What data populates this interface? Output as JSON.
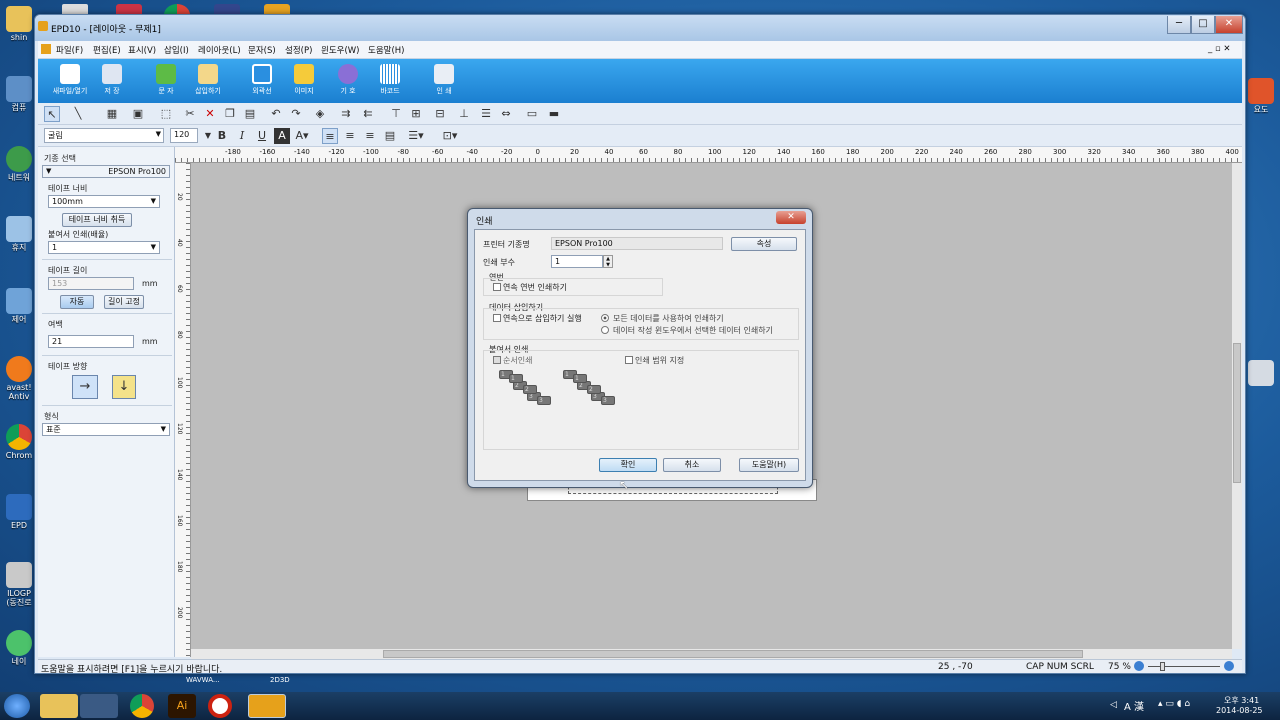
{
  "desktop": {
    "icons": [
      "shin",
      "컴퓨",
      "네트워",
      "휴지",
      "제어",
      "avast! Antiv",
      "Chrom",
      "EPD",
      "ILOGP (동진로",
      "네이"
    ],
    "right_icons": [
      "요도",
      ""
    ],
    "bg_color": "#1c5b9c"
  },
  "window": {
    "title": "EPD10 - [레이아웃 - 무제1]",
    "menu": [
      "파일(F)",
      "편집(E)",
      "표시(V)",
      "삽입(I)",
      "레이아웃(L)",
      "문자(S)",
      "설정(P)",
      "윈도우(W)",
      "도움말(H)"
    ],
    "bigbar": [
      "새파일/열기",
      "저 장",
      "문 자",
      "삽입하기",
      "외곽선",
      "이미지",
      "기 호",
      "바코드",
      "인 쇄"
    ],
    "font_combo": "굴림",
    "size_combo": "120"
  },
  "panel": {
    "model_label": "기종 선택",
    "model_value": "EPSON Pro100",
    "tape_width_label": "테이프 너비",
    "tape_width_value": "100mm",
    "tape_width_btn": "테이프 너비 취득",
    "paste_label": "붙여서 인쇄(배율)",
    "paste_value": "1",
    "tape_length_label": "테이프 길이",
    "tape_length_value": "153",
    "tape_length_unit": "mm",
    "auto_btn": "자동",
    "fixed_btn": "길이 고정",
    "margin_label": "여백",
    "margin_value": "21",
    "margin_unit": "mm",
    "direction_label": "테이프 방향",
    "format_label": "형식",
    "format_value": "표준"
  },
  "ruler": {
    "h_labels": [
      "-180",
      "-160",
      "-140",
      "-120",
      "-100",
      "-80",
      "-60",
      "-40",
      "-20",
      "0",
      "20",
      "40",
      "60",
      "80",
      "100",
      "120",
      "140",
      "160",
      "180",
      "200",
      "220",
      "240",
      "260",
      "280",
      "300",
      "320",
      "340",
      "360",
      "380",
      "400"
    ],
    "v_labels": [
      "20",
      "40",
      "60",
      "80",
      "100",
      "120",
      "140",
      "160",
      "180",
      "200"
    ]
  },
  "dialog": {
    "title": "인쇄",
    "printer_label": "프린터 기종명",
    "printer_value": "EPSON Pro100",
    "props_btn": "속성",
    "copies_label": "인쇄 부수",
    "copies_value": "1",
    "serial_group": "연번",
    "serial_check": "연속 연번 인쇄하기",
    "insert_group": "데이터 삽입하기",
    "insert_check": "연속으로 삽입하기 실행",
    "radio_all": "모든 데이터를 사용하여 인쇄하기",
    "radio_selected": "데이터 작성 윈도우에서 선택한 데이터 인쇄하기",
    "paste_group": "붙여서 인쇄",
    "order_check": "순서인쇄",
    "range_check": "인쇄 범위 지정",
    "ok_btn": "확인",
    "cancel_btn": "취소",
    "help_btn": "도움말(H)"
  },
  "status": {
    "help_text": "도움말을 표시하려면 [F1]을 누르시기 바랍니다.",
    "coords": "25 , -70",
    "caps": "CAP  NUM  SCRL",
    "zoom": "75 %"
  },
  "taskbar": {
    "labels_above": [
      "WAVWA...",
      "2D3D"
    ],
    "clock_time": "오후 3:41",
    "clock_date": "2014-08-25",
    "ime": "A 漢"
  }
}
